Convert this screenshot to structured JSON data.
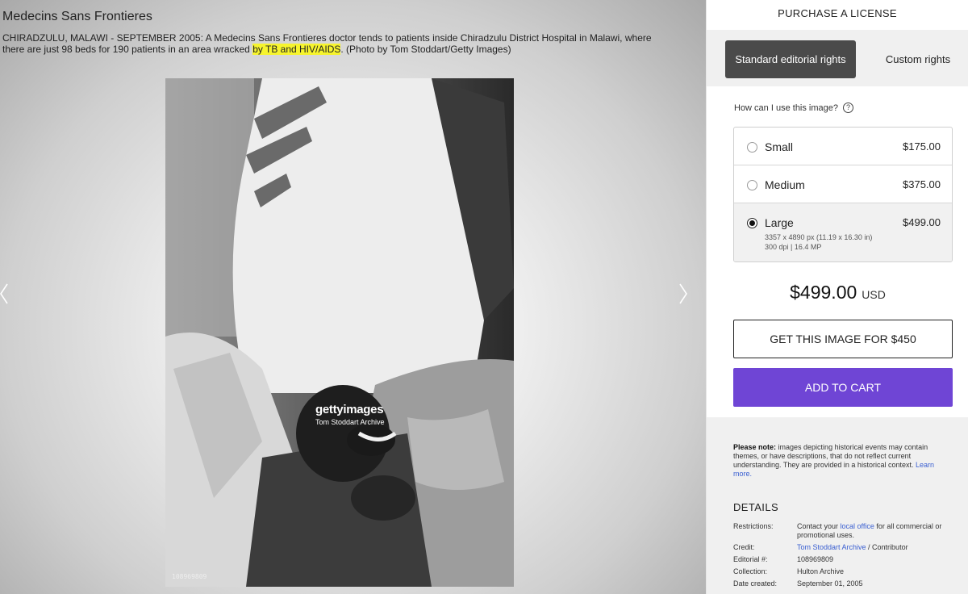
{
  "gallery": {
    "title": "Medecins Sans Frontieres",
    "caption_part1": "CHIRADZULU, MALAWI - SEPTEMBER 2005: A Medecins Sans Frontieres doctor tends to patients inside Chiradzulu District Hospital in Malawi, where there are just 98 beds for 190 patients in an area wracked ",
    "caption_highlight": "by TB and HIV/AIDS",
    "caption_part2": ". (Photo by Tom Stoddart/Getty Images)",
    "watermark_logo": "gettyimages",
    "watermark_sub": "Tom Stoddart Archive",
    "photo_id": "108969809",
    "prev_icon": "chevron-left-icon",
    "next_icon": "chevron-right-icon"
  },
  "panel": {
    "title": "PURCHASE A LICENSE",
    "tabs": [
      {
        "label": "Standard editorial rights",
        "active": true
      },
      {
        "label": "Custom rights",
        "active": false
      }
    ],
    "question": "How can I use this image?",
    "help_icon": "?",
    "sizes": [
      {
        "name": "Small",
        "price": "$175.00",
        "selected": false
      },
      {
        "name": "Medium",
        "price": "$375.00",
        "selected": false
      },
      {
        "name": "Large",
        "price": "$499.00",
        "selected": true,
        "meta1": "3357 x 4890 px (11.19 x 16.30 in)",
        "meta2": "300 dpi | 16.4 MP"
      }
    ],
    "total_price": "$499.00",
    "currency": "USD",
    "get_button": "GET THIS IMAGE FOR $450",
    "cart_button": "ADD TO CART",
    "accent_color": "#6f45d5",
    "note_bold": "Please note:",
    "note_text": " images depicting historical events may contain themes, or have descriptions, that do not reflect current understanding. They are provided in a historical context. ",
    "note_link": "Learn more.",
    "details_title": "DETAILS",
    "details": {
      "restrictions_label": "Restrictions:",
      "restrictions_pre": "Contact your ",
      "restrictions_link": "local office",
      "restrictions_post": " for all commercial or promotional uses.",
      "credit_label": "Credit:",
      "credit_link": "Tom Stoddart Archive",
      "credit_post": " / Contributor",
      "editorial_label": "Editorial #:",
      "editorial_value": "108969809",
      "collection_label": "Collection:",
      "collection_value": "Hulton Archive",
      "date_label": "Date created:",
      "date_value": "September 01, 2005"
    }
  }
}
